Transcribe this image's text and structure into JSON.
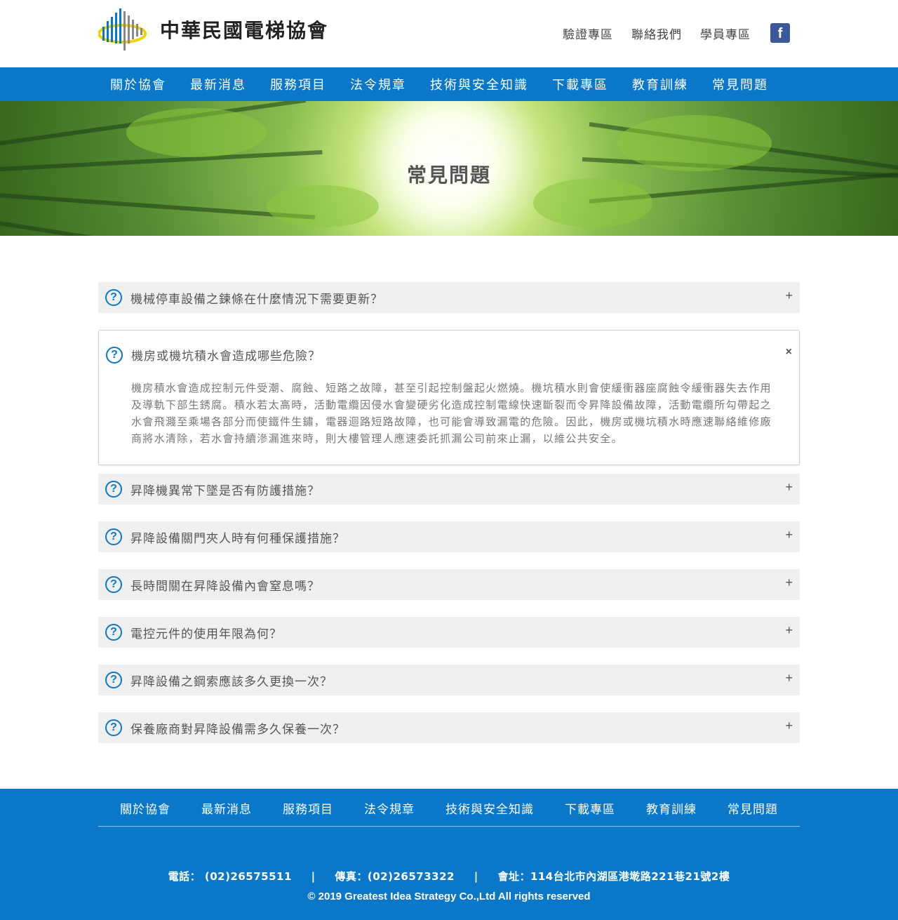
{
  "header": {
    "logo_text": "中華民國電梯協會",
    "top_links": [
      "驗證專區",
      "聯絡我們",
      "學員專區"
    ],
    "facebook_icon": "facebook-icon"
  },
  "nav": {
    "items": [
      "關於協會",
      "最新消息",
      "服務項目",
      "法令規章",
      "技術與安全知識",
      "下載專區",
      "教育訓練",
      "常見問題"
    ]
  },
  "banner": {
    "title": "常見問題"
  },
  "faq": {
    "items": [
      {
        "question": "機械停車設備之鍊條在什麼情況下需要更新？",
        "toggle": "+"
      },
      {
        "question": "機房或機坑積水會造成哪些危險？",
        "toggle": "×",
        "answer": "機房積水會造成控制元件受潮、腐蝕、短路之故障，甚至引起控制盤起火燃燒。機坑積水則會使緩衝器座腐蝕令緩衝器失去作用及導軌下部生銹腐。積水若太高時，活動電纜因侵水會變硬劣化造成控制電線快速斷裂而令昇降設備故障，活動電纜所勾帶起之水會飛濺至乘場各部分而使鐵件生鏽，電器迴路短路故障，也可能會導致漏電的危險。因此，機房或機坑積水時應速聯絡維修廠商將水清除，若水會持續滲漏進來時，則大樓管理人應速委託抓漏公司前來止漏，以維公共安全。"
      },
      {
        "question": "昇降機異常下墜是否有防護措施？",
        "toggle": "+"
      },
      {
        "question": "昇降設備關門夾人時有何種保護措施？",
        "toggle": "+"
      },
      {
        "question": "長時間關在昇降設備內會窒息嗎？",
        "toggle": "+"
      },
      {
        "question": "電控元件的使用年限為何？",
        "toggle": "+"
      },
      {
        "question": "昇降設備之鋼索應該多久更換一次？",
        "toggle": "+"
      },
      {
        "question": "保養廠商對昇降設備需多久保養一次？",
        "toggle": "+"
      }
    ]
  },
  "footer": {
    "nav": [
      "關於協會",
      "最新消息",
      "服務項目",
      "法令規章",
      "技術與安全知識",
      "下載專區",
      "教育訓練",
      "常見問題"
    ],
    "phone": "電話： (02)26575511",
    "fax": "傳真：(02)26573322",
    "address": "會址：114台北市內湖區港墘路221巷21號2樓",
    "separator": "|",
    "copyright": "© 2019 Greatest Idea Strategy Co.,Ltd All rights reserved"
  },
  "colors": {
    "brand_blue": "#0a77c9",
    "faq_bg": "#efefef",
    "facebook": "#3b5998"
  }
}
